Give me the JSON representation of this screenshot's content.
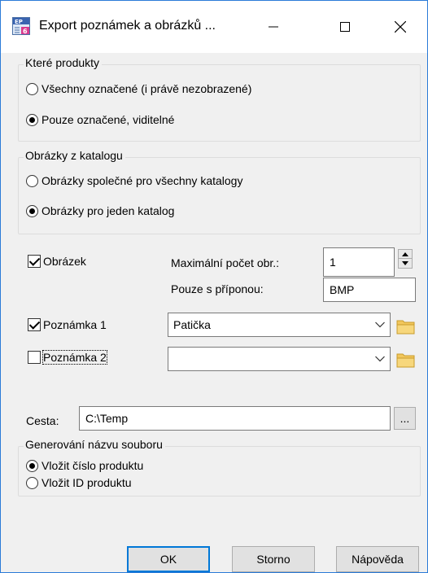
{
  "window": {
    "title": "Export poznámek a obrázků ...",
    "app_icon": "ep-app-icon"
  },
  "products_group": {
    "title": "Které produkty",
    "options": [
      {
        "label": "Všechny označené (i právě nezobrazené)",
        "checked": false
      },
      {
        "label": "Pouze označené, viditelné",
        "checked": true
      }
    ]
  },
  "catalog_group": {
    "title": "Obrázky z katalogu",
    "options": [
      {
        "label": "Obrázky společné pro všechny katalogy",
        "checked": false
      },
      {
        "label": "Obrázky pro jeden katalog",
        "checked": true
      }
    ]
  },
  "image": {
    "checkbox_label": "Obrázek",
    "checked": true,
    "max_count_label": "Maximální počet obr.:",
    "max_count_value": "1",
    "suffix_label": "Pouze s příponou:",
    "suffix_value": "BMP"
  },
  "note1": {
    "checkbox_label": "Poznámka 1",
    "checked": true,
    "combo_value": "Patička"
  },
  "note2": {
    "checkbox_label": "Poznámka 2",
    "checked": false,
    "combo_value": ""
  },
  "path": {
    "label": "Cesta:",
    "value": "C:\\Temp",
    "browse_label": "..."
  },
  "filename_group": {
    "title": "Generování názvu souboru",
    "options": [
      {
        "label": "Vložit číslo produktu",
        "checked": true
      },
      {
        "label": "Vložit ID produktu",
        "checked": false
      }
    ]
  },
  "buttons": {
    "ok": "OK",
    "cancel": "Storno",
    "help": "Nápověda"
  },
  "colors": {
    "accent": "#0078d7",
    "window_border": "#2b7bd8",
    "folder": "#f2c75c"
  }
}
